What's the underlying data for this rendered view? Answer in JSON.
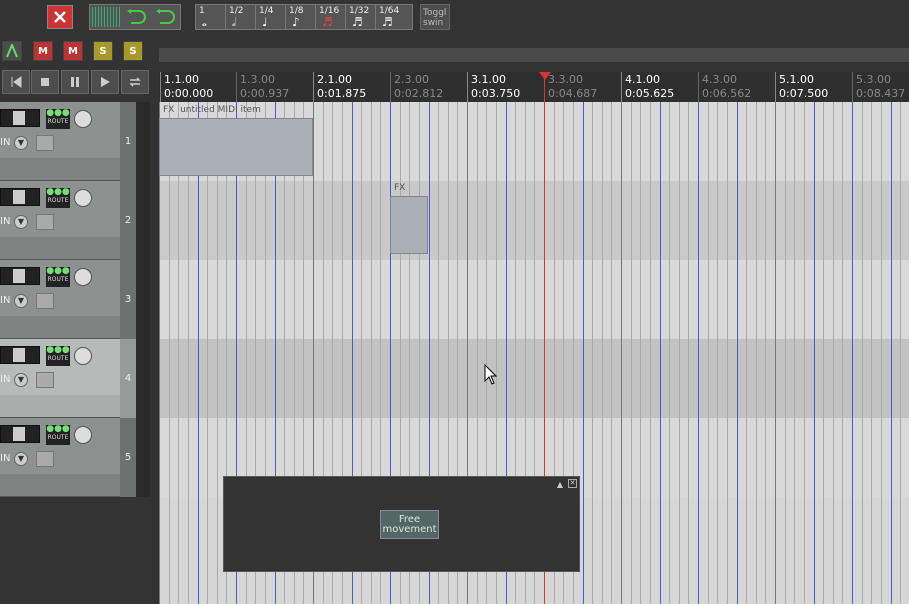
{
  "toolbar": {
    "grid": [
      {
        "label": "1",
        "note": "𝅝"
      },
      {
        "label": "1/2",
        "note": "𝅗𝅥"
      },
      {
        "label": "1/4",
        "note": "♩"
      },
      {
        "label": "1/8",
        "note": "♪"
      },
      {
        "label": "1/16",
        "note": "♬"
      },
      {
        "label": "1/32",
        "note": "♬"
      },
      {
        "label": "1/64",
        "note": "♬"
      }
    ],
    "toggle_swing": "Toggl swin",
    "track_buttons": [
      "M",
      "M",
      "S",
      "S"
    ]
  },
  "ruler": {
    "marks": [
      {
        "measure": "1.1.00",
        "time": "0:00.000",
        "major": true
      },
      {
        "measure": "1.3.00",
        "time": "0:00.937",
        "major": false
      },
      {
        "measure": "2.1.00",
        "time": "0:01.875",
        "major": true
      },
      {
        "measure": "2.3.00",
        "time": "0:02.812",
        "major": false
      },
      {
        "measure": "3.1.00",
        "time": "0:03.750",
        "major": true
      },
      {
        "measure": "3.3.00",
        "time": "0:04.687",
        "major": false
      },
      {
        "measure": "4.1.00",
        "time": "0:05.625",
        "major": true
      },
      {
        "measure": "4.3.00",
        "time": "0:06.562",
        "major": false
      },
      {
        "measure": "5.1.00",
        "time": "0:07.500",
        "major": true
      },
      {
        "measure": "5.3.00",
        "time": "0:08.437",
        "major": false
      }
    ]
  },
  "tracks": [
    {
      "number": "1",
      "in": "IN",
      "route": "ROUTE"
    },
    {
      "number": "2",
      "in": "IN",
      "route": "ROUTE"
    },
    {
      "number": "3",
      "in": "IN",
      "route": "ROUTE"
    },
    {
      "number": "4",
      "in": "IN",
      "route": "ROUTE"
    },
    {
      "number": "5",
      "in": "IN",
      "route": "ROUTE"
    }
  ],
  "items": {
    "item1_fx": "FX",
    "item1_name": "untitled MIDI item",
    "item2_fx": "FX"
  },
  "float_window": {
    "button_label": "Free movement",
    "pin": "▲",
    "close": "✕"
  },
  "colors": {
    "playcursor": "#dd3333",
    "grid_blue": "#5555cc",
    "item_fill": "#a9b0b6"
  }
}
